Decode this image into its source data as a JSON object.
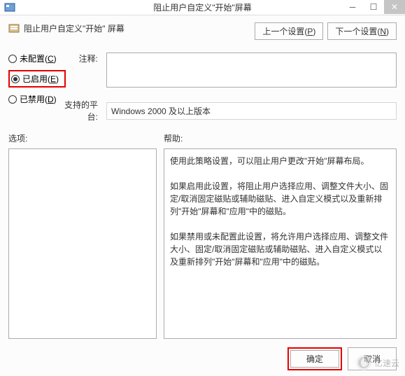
{
  "titlebar": {
    "title": "阻止用户自定义\"开始\"屏幕"
  },
  "header": {
    "policy_title": "阻止用户自定义\"开始\" 屏幕",
    "prev_btn": "上一个设置(",
    "prev_hotkey": "P",
    "prev_btn_end": ")",
    "next_btn": "下一个设置(",
    "next_hotkey": "N",
    "next_btn_end": ")"
  },
  "radios": {
    "not_configured": "未配置(",
    "not_configured_key": "C",
    "not_configured_end": ")",
    "enabled": "已启用(",
    "enabled_key": "E",
    "enabled_end": ")",
    "disabled": "已禁用(",
    "disabled_key": "D",
    "disabled_end": ")"
  },
  "labels": {
    "comment": "注释:",
    "platform": "支持的平台:",
    "options": "选项:",
    "help": "帮助:"
  },
  "platform_text": "Windows 2000 及以上版本",
  "help_text": "使用此策略设置，可以阻止用户更改\"开始\"屏幕布局。\n\n如果启用此设置，将阻止用户选择应用、调整文件大小、固定/取消固定磁贴或辅助磁贴、进入自定义模式以及重新排列\"开始\"屏幕和\"应用\"中的磁贴。\n\n如果禁用或未配置此设置，将允许用户选择应用、调整文件大小、固定/取消固定磁贴或辅助磁贴、进入自定义模式以及重新排列\"开始\"屏幕和\"应用\"中的磁贴。",
  "footer": {
    "ok": "确定",
    "cancel": "取消"
  },
  "watermark": "亿速云"
}
